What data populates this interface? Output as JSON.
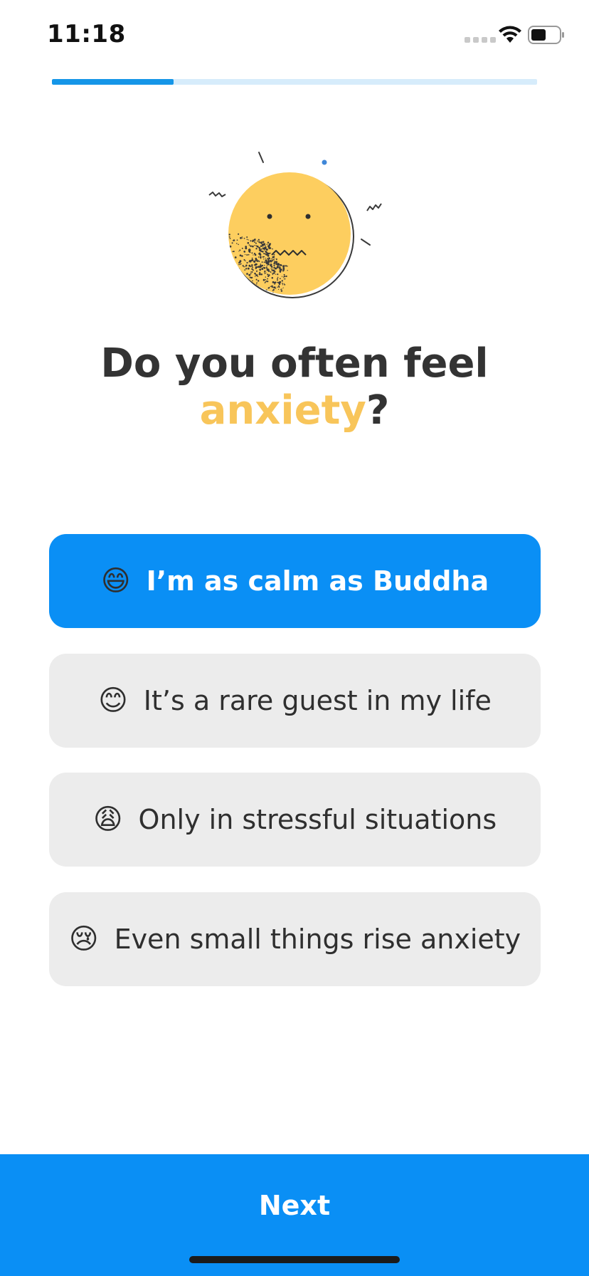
{
  "status_bar": {
    "time": "11:18",
    "wifi_icon": "wifi-icon",
    "battery_icon": "battery-icon"
  },
  "progress": {
    "fraction": 0.25,
    "fill_color": "#1596e8",
    "track_color": "#d6ecfb"
  },
  "illustration": {
    "icon": "anxious-face-illustration"
  },
  "question": {
    "prefix": "Do you often feel",
    "highlight": "anxiety",
    "suffix": "?",
    "highlight_color": "#f8c55a"
  },
  "options": [
    {
      "emoji": "😄",
      "label": "I’m as calm as Buddha",
      "selected": true
    },
    {
      "emoji": "😊",
      "label": "It’s a rare guest in my life",
      "selected": false
    },
    {
      "emoji": "😩",
      "label": "Only in stressful situations",
      "selected": false
    },
    {
      "emoji": "😢",
      "label": "Even small things rise anxiety",
      "selected": false
    }
  ],
  "next_button": {
    "label": "Next",
    "color": "#0a8ff5"
  }
}
